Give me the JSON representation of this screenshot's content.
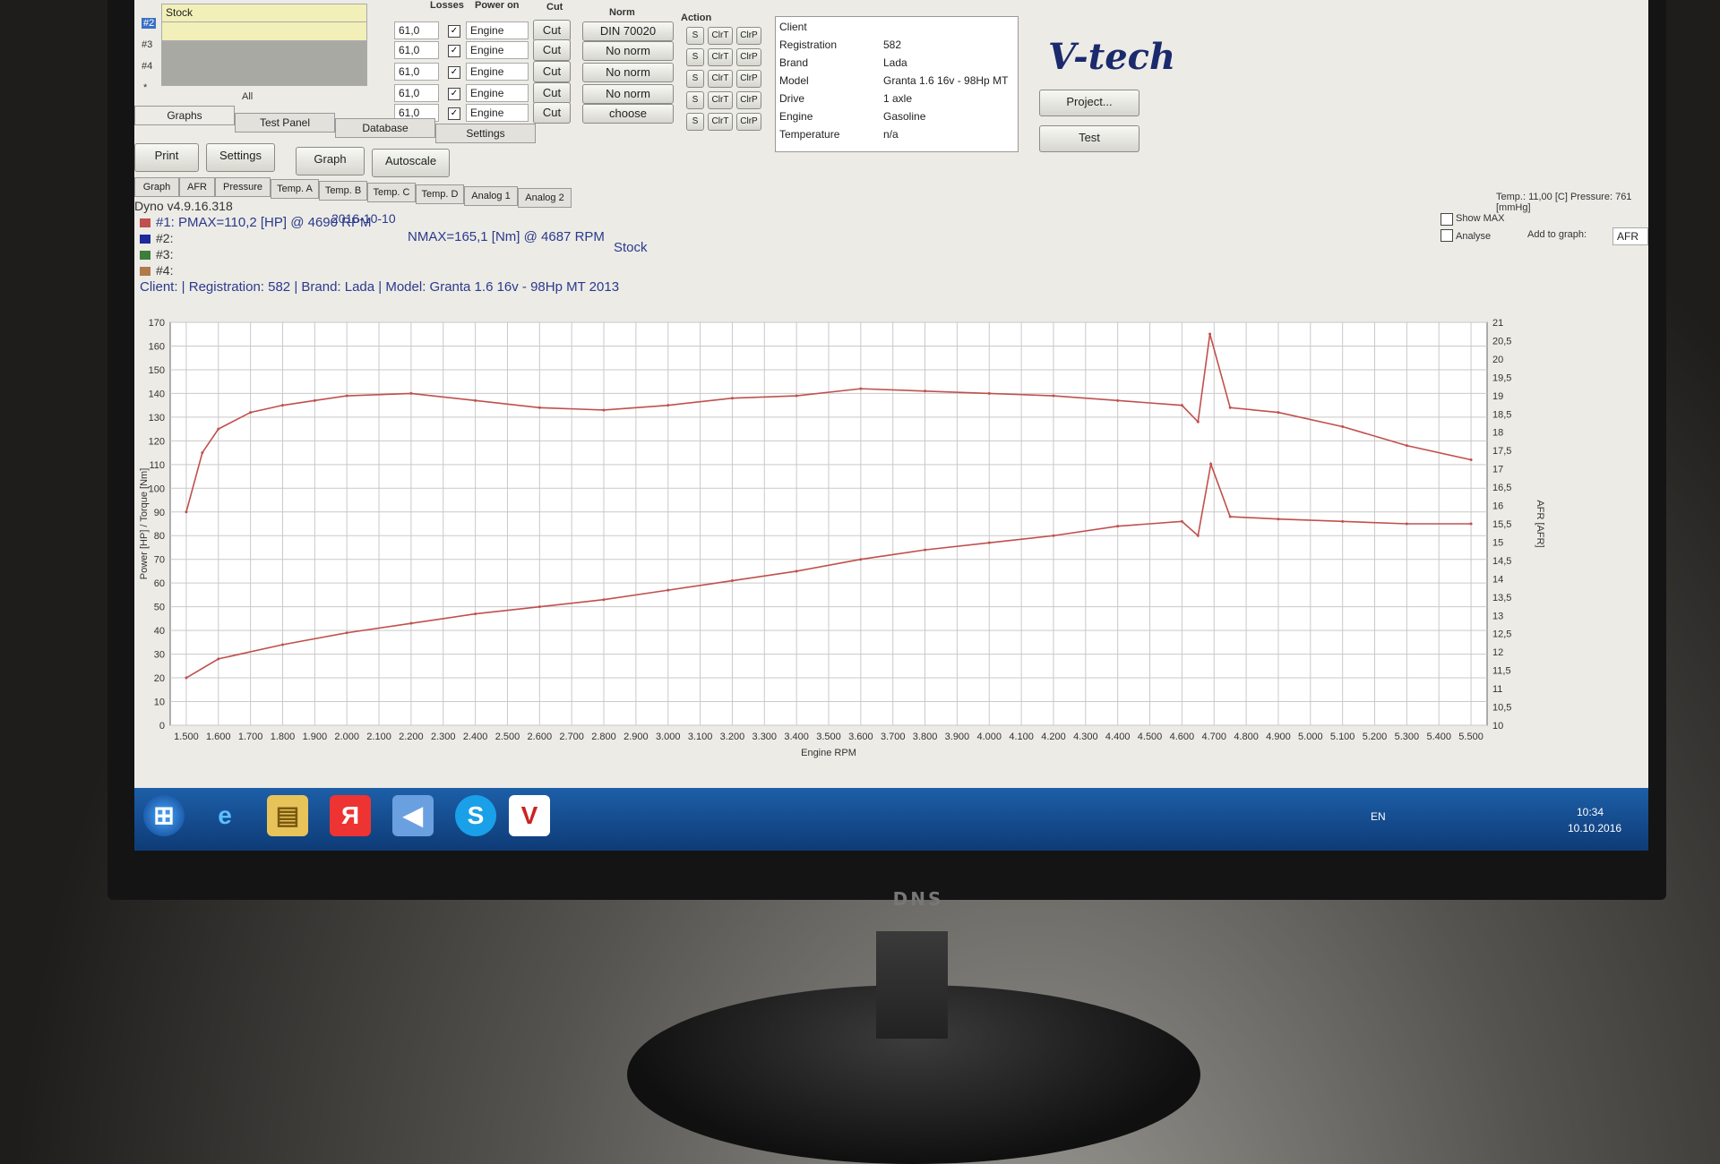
{
  "app": {
    "logo": "V-tech",
    "version": "Dyno v4.9.16.318",
    "date": "2016-10-10"
  },
  "rows": [
    {
      "id": "#2",
      "loss": "61,0",
      "power_on": "Engine",
      "cut": "Cut",
      "norm": "DIN 70020"
    },
    {
      "id": "#3",
      "loss": "61,0",
      "power_on": "Engine",
      "cut": "Cut",
      "norm": "No norm"
    },
    {
      "id": "#4",
      "loss": "61,0",
      "power_on": "Engine",
      "cut": "Cut",
      "norm": "No norm"
    },
    {
      "id": "*",
      "loss": "61,0",
      "power_on": "Engine",
      "cut": "Cut",
      "norm": "No norm"
    },
    {
      "id": "",
      "loss": "61,0",
      "power_on": "Engine",
      "cut": "Cut",
      "norm": "choose"
    }
  ],
  "stock_label": "Stock",
  "all_label": "All",
  "col_headers": {
    "losses": "Losses",
    "power_on": "Power on",
    "cut": "Cut",
    "norm": "Norm",
    "action": "Action"
  },
  "action_buttons": {
    "s": "S",
    "clrt": "ClrT",
    "clrp": "ClrP"
  },
  "info": [
    {
      "label": "Client",
      "value": ""
    },
    {
      "label": "Registration",
      "value": "582"
    },
    {
      "label": "Brand",
      "value": "Lada"
    },
    {
      "label": "Model",
      "value": "Granta 1.6 16v - 98Hp MT"
    },
    {
      "label": "Drive",
      "value": "1 axle"
    },
    {
      "label": "Engine",
      "value": "Gasoline"
    },
    {
      "label": "Temperature",
      "value": "n/a"
    }
  ],
  "right_buttons": {
    "project": "Project...",
    "test": "Test"
  },
  "main_tabs": [
    "Graphs",
    "Test Panel",
    "Database",
    "Settings"
  ],
  "toolbar": {
    "print": "Print",
    "settings": "Settings",
    "graph": "Graph",
    "autoscale": "Autoscale"
  },
  "sub_tabs": [
    "Graph",
    "AFR",
    "Pressure",
    "Temp. A",
    "Temp. B",
    "Temp. C",
    "Temp. D",
    "Analog 1",
    "Analog 2"
  ],
  "env": "Temp.: 11,00 [C]   Pressure: 761 [mmHg]",
  "options": {
    "show_max": "Show MAX",
    "analyse": "Analyse",
    "add_to_graph": "Add to graph:",
    "add_value": "AFR"
  },
  "legend": {
    "l1": "#1: PMAX=110,2 [HP] @ 4690 RPM",
    "nmax": "NMAX=165,1 [Nm] @ 4687 RPM",
    "stock": "Stock",
    "l2": "#2:",
    "l3": "#3:",
    "l4": "#4:",
    "client": "Client:  | Registration: 582 | Brand: Lada | Model: Granta 1.6 16v - 98Hp MT 2013"
  },
  "chart_data": {
    "type": "line",
    "xlabel": "Engine RPM",
    "ylabel": "Power [HP] / Torque [Nm]",
    "y2label": "AFR [AFR]",
    "xlim": [
      1450,
      5550
    ],
    "ylim": [
      0,
      170
    ],
    "y2lim": [
      10,
      21
    ],
    "x_ticks": [
      "1.500",
      "1.600",
      "1.700",
      "1.800",
      "1.900",
      "2.000",
      "2.100",
      "2.200",
      "2.300",
      "2.400",
      "2.500",
      "2.600",
      "2.700",
      "2.800",
      "2.900",
      "3.000",
      "3.100",
      "3.200",
      "3.300",
      "3.400",
      "3.500",
      "3.600",
      "3.700",
      "3.800",
      "3.900",
      "4.000",
      "4.100",
      "4.200",
      "4.300",
      "4.400",
      "4.500",
      "4.600",
      "4.700",
      "4.800",
      "4.900",
      "5.000",
      "5.100",
      "5.200",
      "5.300",
      "5.400",
      "5.500"
    ],
    "y_ticks": [
      0,
      10,
      20,
      30,
      40,
      50,
      60,
      70,
      80,
      90,
      100,
      110,
      120,
      130,
      140,
      150,
      160,
      170
    ],
    "y2_ticks": [
      "10",
      "10,5",
      "11",
      "11,5",
      "12",
      "12,5",
      "13",
      "13,5",
      "14",
      "14,5",
      "15",
      "15,5",
      "16",
      "16,5",
      "17",
      "17,5",
      "18",
      "18,5",
      "19",
      "19,5",
      "20",
      "20,5",
      "21"
    ],
    "series": [
      {
        "name": "Torque",
        "color": "#c0504d",
        "x": [
          1500,
          1550,
          1600,
          1700,
          1800,
          1900,
          2000,
          2200,
          2400,
          2600,
          2800,
          3000,
          3200,
          3400,
          3600,
          3800,
          4000,
          4200,
          4400,
          4600,
          4650,
          4687,
          4750,
          4900,
          5100,
          5300,
          5500
        ],
        "y": [
          90,
          115,
          125,
          132,
          135,
          137,
          139,
          140,
          137,
          134,
          133,
          135,
          138,
          139,
          142,
          141,
          140,
          139,
          137,
          135,
          128,
          165.1,
          134,
          132,
          126,
          118,
          112
        ]
      },
      {
        "name": "Power",
        "color": "#c0504d",
        "x": [
          1500,
          1600,
          1800,
          2000,
          2200,
          2400,
          2600,
          2800,
          3000,
          3200,
          3400,
          3600,
          3800,
          4000,
          4200,
          4400,
          4600,
          4650,
          4690,
          4750,
          4900,
          5100,
          5300,
          5500
        ],
        "y": [
          20,
          28,
          34,
          39,
          43,
          47,
          50,
          53,
          57,
          61,
          65,
          70,
          74,
          77,
          80,
          84,
          86,
          80,
          110.2,
          88,
          87,
          86,
          85,
          85
        ]
      }
    ]
  }
}
